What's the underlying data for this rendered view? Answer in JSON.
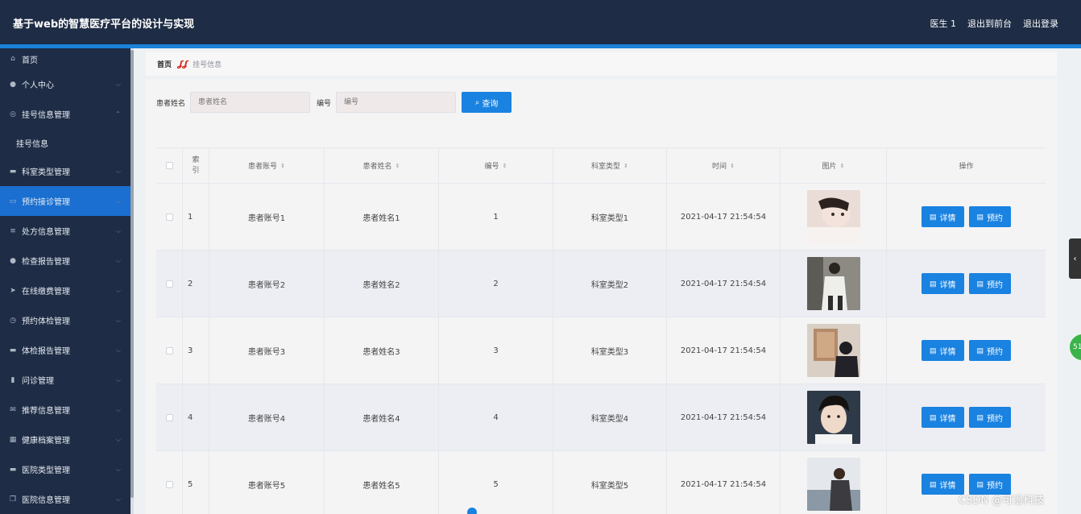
{
  "header": {
    "title": "基于web的智慧医疗平台的设计与实现",
    "user": "医生 1",
    "to_front": "退出到前台",
    "logout": "退出登录"
  },
  "sidebar": {
    "items": [
      {
        "label": "首页",
        "icon": "home-icon"
      },
      {
        "label": "个人中心",
        "icon": "user-icon"
      },
      {
        "label": "挂号信息管理",
        "icon": "globe-icon"
      },
      {
        "label": "挂号信息",
        "icon": ""
      },
      {
        "label": "科室类型管理",
        "icon": "message-icon"
      },
      {
        "label": "预约接诊管理",
        "icon": "chat-icon"
      },
      {
        "label": "处方信息管理",
        "icon": "list-icon"
      },
      {
        "label": "检查报告管理",
        "icon": "user-icon"
      },
      {
        "label": "在线缴费管理",
        "icon": "send-icon"
      },
      {
        "label": "预约体检管理",
        "icon": "compass-icon"
      },
      {
        "label": "体检报告管理",
        "icon": "message-icon"
      },
      {
        "label": "问诊管理",
        "icon": "bar-chart-icon"
      },
      {
        "label": "推荐信息管理",
        "icon": "mail-icon"
      },
      {
        "label": "健康档案管理",
        "icon": "grid-icon"
      },
      {
        "label": "医院类型管理",
        "icon": "message-icon"
      },
      {
        "label": "医院信息管理",
        "icon": "copy-icon"
      }
    ],
    "active_index": 5
  },
  "breadcrumb": {
    "home": "首页",
    "current": "挂号信息"
  },
  "search": {
    "name_label": "患者姓名",
    "name_placeholder": "患者姓名",
    "number_label": "编号",
    "number_placeholder": "编号",
    "button_label": "查询"
  },
  "table": {
    "headers": [
      "索引",
      "患者账号",
      "患者姓名",
      "编号",
      "科室类型",
      "时间",
      "图片",
      "操作"
    ],
    "rows": [
      {
        "index": "1",
        "account": "患者账号1",
        "name": "患者姓名1",
        "number": "1",
        "dept": "科室类型1",
        "time": "2021-04-17 21:54:54"
      },
      {
        "index": "2",
        "account": "患者账号2",
        "name": "患者姓名2",
        "number": "2",
        "dept": "科室类型2",
        "time": "2021-04-17 21:54:54"
      },
      {
        "index": "3",
        "account": "患者账号3",
        "name": "患者姓名3",
        "number": "3",
        "dept": "科室类型3",
        "time": "2021-04-17 21:54:54"
      },
      {
        "index": "4",
        "account": "患者账号4",
        "name": "患者姓名4",
        "number": "4",
        "dept": "科室类型4",
        "time": "2021-04-17 21:54:54"
      },
      {
        "index": "5",
        "account": "患者账号5",
        "name": "患者姓名5",
        "number": "5",
        "dept": "科室类型5",
        "time": "2021-04-17 21:54:54"
      }
    ],
    "detail_label": "详情",
    "book_label": "预约"
  },
  "overlay": {
    "badge_text": "51",
    "watermark": "CSDN @可沿科技"
  },
  "colors": {
    "header_bg": "#1e2c45",
    "accent": "#1a82e0",
    "active_menu": "#1a6fd0"
  }
}
